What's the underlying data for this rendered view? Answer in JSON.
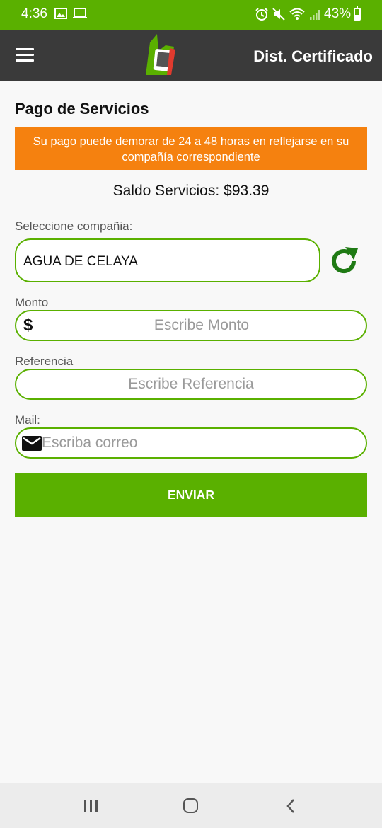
{
  "status_bar": {
    "time": "4:36",
    "battery_pct": "43%",
    "battery_level": 0.43
  },
  "app_bar": {
    "title": "Dist. Certificado",
    "menu_icon": "hamburger-menu-icon",
    "logo_icon": "brand-logo-icon"
  },
  "main": {
    "section_title": "Pago de Servicios",
    "notice": "Su pago puede demorar de 24 a 48 horas en reflejarse en su compañía correspondiente",
    "balance_label": "Saldo Servicios:",
    "balance_value": "$93.39",
    "company": {
      "label": "Seleccione compañia:",
      "selected": "AGUA DE CELAYA",
      "refresh_icon": "refresh-icon"
    },
    "amount": {
      "label": "Monto",
      "currency_symbol": "$",
      "placeholder": "Escribe Monto",
      "value": ""
    },
    "reference": {
      "label": "Referencia",
      "placeholder": "Escribe Referencia",
      "value": ""
    },
    "mail": {
      "label": "Mail:",
      "placeholder": "Escriba correo",
      "value": "",
      "icon": "envelope-icon"
    },
    "submit_label": "ENVIAR"
  },
  "nav_bar": {
    "recents_icon": "recents-icon",
    "home_icon": "home-icon",
    "back_icon": "back-icon"
  },
  "colors": {
    "accent_green": "#5ab000",
    "notice_orange": "#f5810f",
    "app_bar_bg": "#3a3a3a",
    "refresh_green": "#1f7a14"
  }
}
